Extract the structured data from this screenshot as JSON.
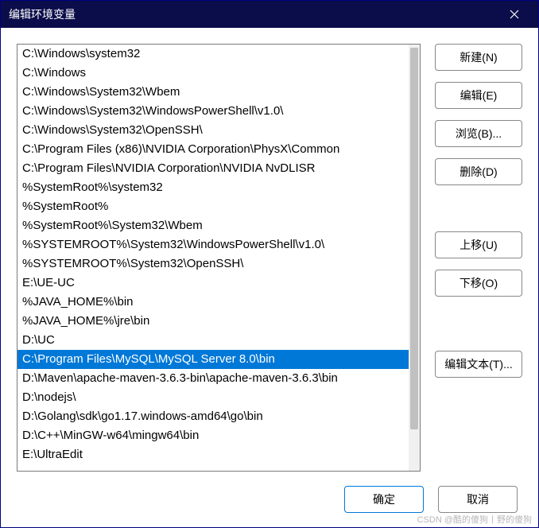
{
  "window": {
    "title": "编辑环境变量"
  },
  "list": {
    "items": [
      "C:\\Windows\\system32",
      "C:\\Windows",
      "C:\\Windows\\System32\\Wbem",
      "C:\\Windows\\System32\\WindowsPowerShell\\v1.0\\",
      "C:\\Windows\\System32\\OpenSSH\\",
      "C:\\Program Files (x86)\\NVIDIA Corporation\\PhysX\\Common",
      "C:\\Program Files\\NVIDIA Corporation\\NVIDIA NvDLISR",
      "%SystemRoot%\\system32",
      "%SystemRoot%",
      "%SystemRoot%\\System32\\Wbem",
      "%SYSTEMROOT%\\System32\\WindowsPowerShell\\v1.0\\",
      "%SYSTEMROOT%\\System32\\OpenSSH\\",
      "E:\\UE-UC",
      "%JAVA_HOME%\\bin",
      "%JAVA_HOME%\\jre\\bin",
      "D:\\UC",
      "C:\\Program Files\\MySQL\\MySQL Server 8.0\\bin",
      "D:\\Maven\\apache-maven-3.6.3-bin\\apache-maven-3.6.3\\bin",
      "D:\\nodejs\\",
      "D:\\Golang\\sdk\\go1.17.windows-amd64\\go\\bin",
      "D:\\C++\\MinGW-w64\\mingw64\\bin",
      "E:\\UltraEdit"
    ],
    "selected_index": 16
  },
  "buttons": {
    "new": "新建(N)",
    "edit": "编辑(E)",
    "browse": "浏览(B)...",
    "delete": "删除(D)",
    "move_up": "上移(U)",
    "move_down": "下移(O)",
    "edit_text": "编辑文本(T)...",
    "ok": "确定",
    "cancel": "取消"
  },
  "watermark": "CSDN @酷的傻狗丨野的傻狗"
}
